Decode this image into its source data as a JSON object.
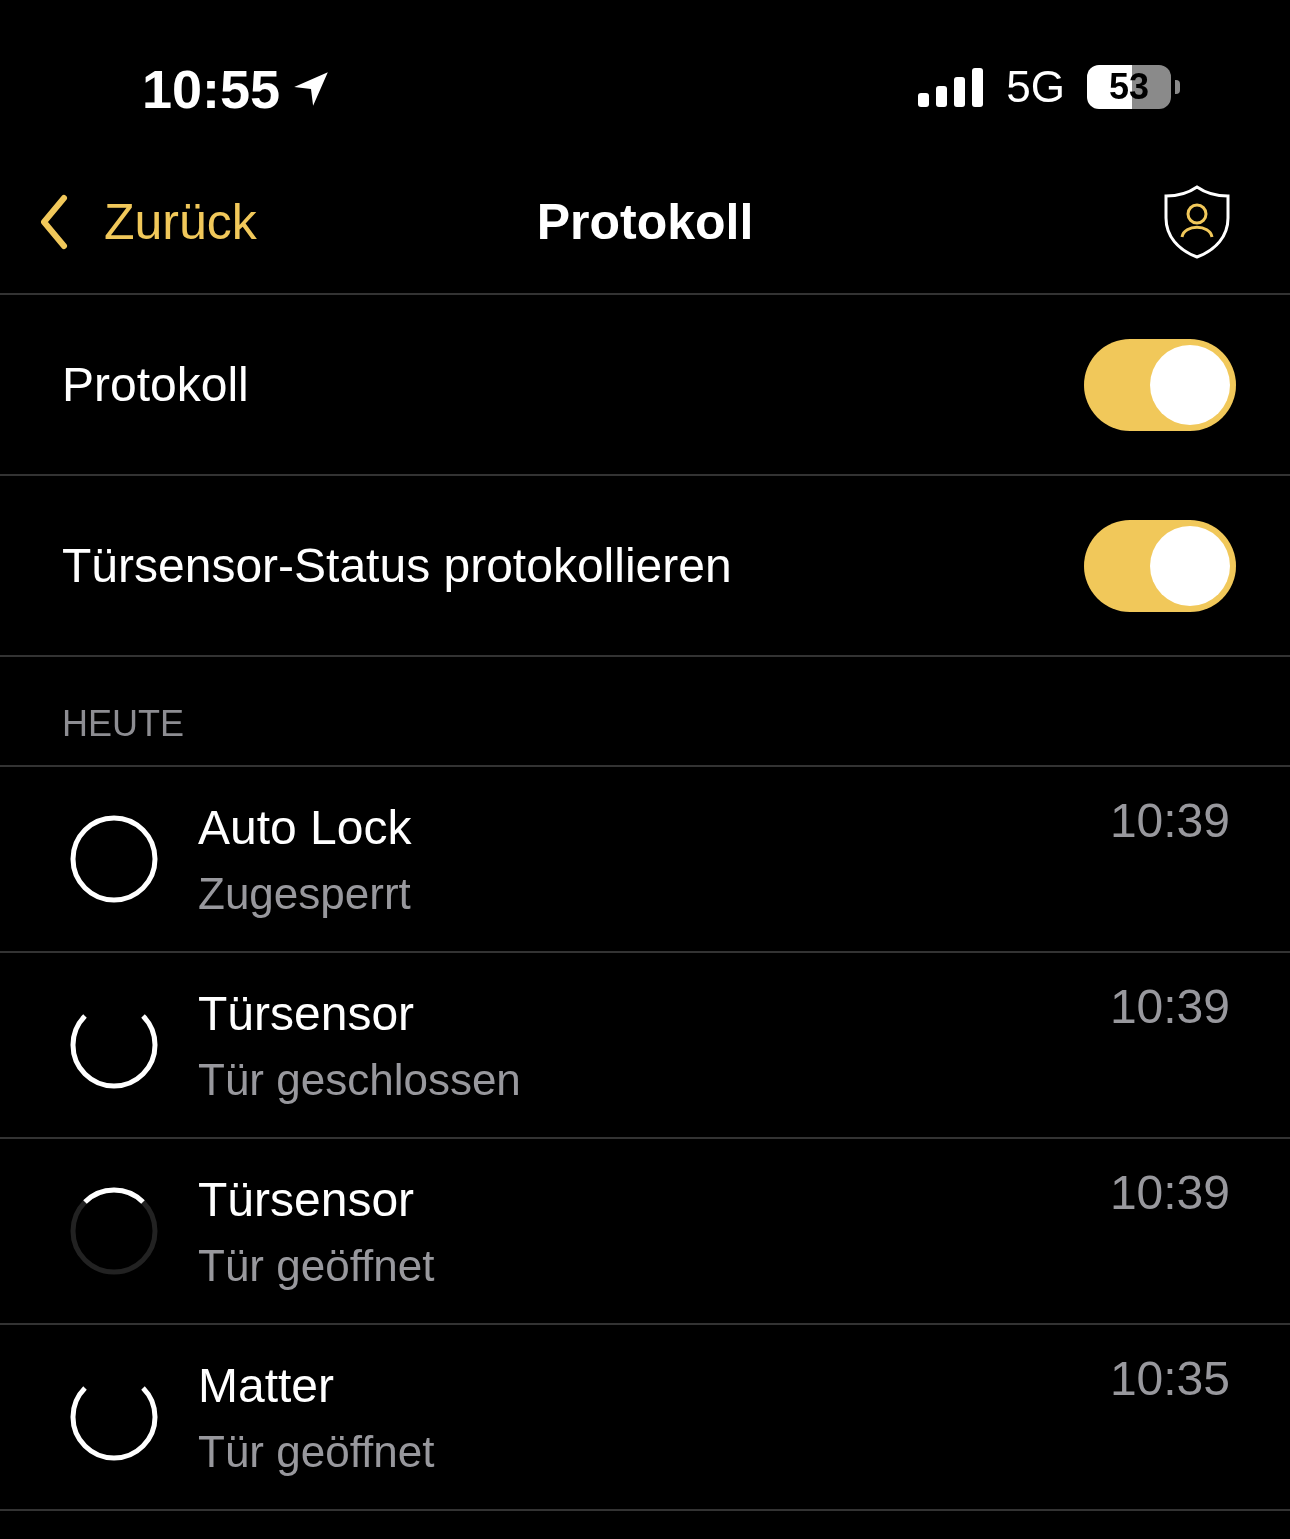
{
  "status_bar": {
    "time": "10:55",
    "network": "5G",
    "battery": "53"
  },
  "nav": {
    "back": "Zurück",
    "title": "Protokoll"
  },
  "settings": [
    {
      "label": "Protokoll",
      "on": true
    },
    {
      "label": "Türsensor-Status protokollieren",
      "on": true
    }
  ],
  "section": "HEUTE",
  "entries": [
    {
      "kind": "full",
      "title": "Auto Lock",
      "subtitle": "Zugesperrt",
      "time": "10:39"
    },
    {
      "kind": "open-top",
      "title": "Türsensor",
      "subtitle": "Tür geschlossen",
      "time": "10:39"
    },
    {
      "kind": "top-arc",
      "title": "Türsensor",
      "subtitle": "Tür geöffnet",
      "time": "10:39"
    },
    {
      "kind": "open-top",
      "title": "Matter",
      "subtitle": "Tür geöffnet",
      "time": "10:35"
    }
  ]
}
